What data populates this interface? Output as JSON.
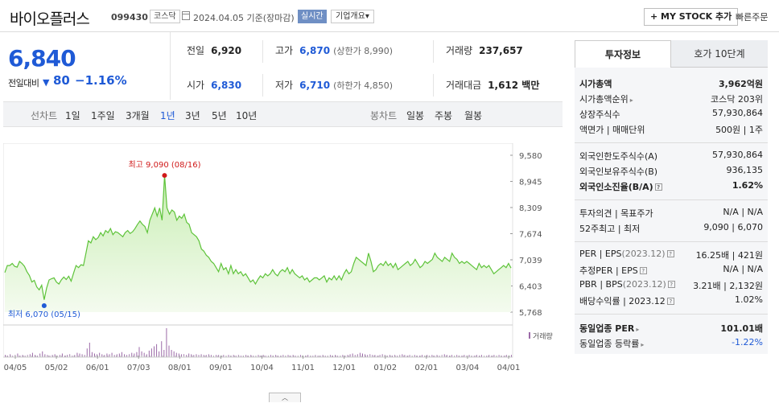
{
  "header": {
    "title": "바이오플러스",
    "code": "099430",
    "market": "코스닥",
    "date": "2024.04.05",
    "status": "기준(장마감)",
    "live": "실시간",
    "company_info": "기업개요",
    "company_info_caret": "▾",
    "mystock": "+ MY STOCK 추가",
    "quick_order": "빠른주문"
  },
  "price": {
    "current": "6,840",
    "change_label": "전일대비",
    "change_symbol": "▼",
    "change": "80",
    "change_pct": "−1.16%"
  },
  "stats": {
    "prev_close": {
      "label": "전일",
      "value": "6,920"
    },
    "high": {
      "label": "고가",
      "value": "6,870",
      "sub": "(상한가 8,990)"
    },
    "volume": {
      "label": "거래량",
      "value": "237,657"
    },
    "open": {
      "label": "시가",
      "value": "6,830"
    },
    "low": {
      "label": "저가",
      "value": "6,710",
      "sub": "(하한가 4,850)"
    },
    "amount": {
      "label": "거래대금",
      "value": "1,612 백만"
    }
  },
  "tabs": {
    "line_label": "선차트",
    "periods": [
      "1일",
      "1주일",
      "3개월",
      "1년",
      "3년",
      "5년",
      "10년"
    ],
    "active": "1년",
    "candle_label": "봉차트",
    "candles": [
      "일봉",
      "주봉",
      "월봉"
    ]
  },
  "chart_data": {
    "type": "area",
    "title": "",
    "xlabel": "",
    "ylabel": "",
    "ylim": [
      5768,
      9580
    ],
    "yticks": [
      "9,580",
      "8,945",
      "8,309",
      "7,674",
      "7,039",
      "6,403",
      "5,768"
    ],
    "x_ticks": [
      "04/05",
      "05/02",
      "06/01",
      "07/03",
      "08/01",
      "09/01",
      "10/04",
      "11/01",
      "12/01",
      "01/02",
      "02/01",
      "03/04",
      "04/01"
    ],
    "series": [
      {
        "values": [
          6730,
          6900,
          6900,
          6950,
          6880,
          6860,
          7000,
          6950,
          6880,
          6750,
          6660,
          6500,
          6540,
          6380,
          6310,
          6420,
          6070,
          6350,
          6550,
          6580,
          6600,
          6500,
          6450,
          6550,
          6620,
          6560,
          6640,
          6520,
          6720,
          6900,
          6850,
          6920,
          6900,
          7200,
          7500,
          7450,
          7600,
          7530,
          7580,
          7700,
          7620,
          7750,
          7700,
          7800,
          7650,
          7720,
          7700,
          7650,
          7600,
          7700,
          7750,
          7680,
          7720,
          7800,
          7900,
          7980,
          7900,
          7850,
          7700,
          8000,
          8150,
          8300,
          8100,
          8300,
          8000,
          9090,
          8300,
          8150,
          8250,
          8200,
          8000,
          8100,
          8050,
          8150,
          7950,
          7900,
          7700,
          7650,
          7600,
          7500,
          7300,
          7250,
          7150,
          7100,
          7000,
          6950,
          6850,
          6750,
          6950,
          6800,
          6850,
          6700,
          6900,
          6700,
          6800,
          6700,
          6750,
          6650,
          6700,
          6600,
          6500,
          6550,
          6450,
          6560,
          6650,
          6600,
          6700,
          6650,
          6700,
          6800,
          6700,
          6650,
          6750,
          6800,
          6750,
          6850,
          6700,
          6800,
          6700,
          6650,
          6600,
          6650,
          6550,
          6600,
          6500,
          6550,
          6600,
          6600,
          6550,
          6600,
          6650,
          6500,
          6600,
          6550,
          6650,
          6550,
          6650,
          6550,
          6700,
          6800,
          6700,
          6750,
          6950,
          7100,
          7050,
          7000,
          6950,
          6900,
          7200,
          7000,
          6750,
          6800,
          6900,
          6950,
          6900,
          7000,
          6900,
          6950,
          6850,
          6950,
          6800,
          6850,
          6900,
          6950,
          7000,
          6900,
          6950,
          7050,
          6950,
          6850,
          6900,
          7000,
          6950,
          7000,
          7050,
          7200,
          7100,
          7050,
          7000,
          7100,
          7050,
          7000,
          7200,
          7100,
          7050,
          6950,
          7000,
          6950,
          7000,
          6950,
          6900,
          6850,
          6800,
          6950,
          6850,
          6900,
          6850,
          6900,
          6800,
          6700,
          6750,
          6800,
          6850,
          6900,
          6850,
          6950,
          6840
        ]
      }
    ],
    "max_label": "최고 9,090 (08/16)",
    "min_label": "최저 6,070 (05/15)",
    "max_index": 65,
    "min_index": 16,
    "volume_label": "거래량",
    "volume": [
      3,
      2,
      4,
      2,
      3,
      5,
      2,
      3,
      2,
      3,
      4,
      6,
      3,
      2,
      5,
      8,
      4,
      3,
      2,
      3,
      4,
      2,
      3,
      5,
      2,
      3,
      4,
      2,
      3,
      6,
      5,
      4,
      3,
      12,
      20,
      7,
      5,
      4,
      6,
      4,
      3,
      5,
      4,
      6,
      3,
      4,
      5,
      7,
      4,
      3,
      4,
      6,
      5,
      7,
      14,
      8,
      6,
      4,
      9,
      12,
      15,
      18,
      8,
      22,
      10,
      40,
      16,
      10,
      8,
      6,
      5,
      4,
      4,
      3,
      5,
      4,
      3,
      4,
      3,
      4,
      3,
      3,
      4,
      3,
      2,
      3,
      3,
      2,
      3,
      2,
      3,
      2,
      3,
      2,
      3,
      2,
      2,
      3,
      2,
      3,
      2,
      2,
      3,
      2,
      3,
      2,
      2,
      3,
      2,
      3,
      2,
      2,
      3,
      2,
      3,
      2,
      3,
      2,
      2,
      3,
      2,
      2,
      3,
      2,
      2,
      3,
      2,
      2,
      3,
      2,
      2,
      3,
      2,
      3,
      2,
      2,
      3,
      2,
      3,
      4,
      5,
      3,
      4,
      6,
      5,
      4,
      3,
      4,
      3,
      3,
      2,
      3,
      4,
      3,
      2,
      3,
      2,
      3,
      2,
      3,
      4,
      3,
      2,
      3,
      2,
      3,
      2,
      2,
      3,
      2,
      3,
      2,
      3,
      2,
      3,
      2,
      3,
      4,
      3,
      2,
      3,
      2,
      3,
      2,
      2,
      3,
      2,
      3,
      2,
      2,
      3,
      2,
      3,
      2,
      2,
      3,
      2,
      3,
      2,
      3,
      2,
      2,
      3,
      2,
      3
    ]
  },
  "side": {
    "tab_invest": "투자정보",
    "tab_orderbook": "호가 10단계",
    "market_cap": {
      "label": "시가총액",
      "value": "3,962억원"
    },
    "cap_rank": {
      "label": "시가총액순위",
      "value": "코스닥 203위"
    },
    "shares": {
      "label": "상장주식수",
      "value": "57,930,864"
    },
    "par": {
      "label": "액면가 | 매매단위",
      "value": "500원 | 1주"
    },
    "foreign_limit": {
      "label": "외국인한도주식수(A)",
      "value": "57,930,864"
    },
    "foreign_hold": {
      "label": "외국인보유주식수(B)",
      "value": "936,135"
    },
    "foreign_ratio": {
      "label": "외국인소진율(B/A)",
      "value": "1.62%"
    },
    "opinion": {
      "label": "투자의견 | 목표주가",
      "value": "N/A | N/A"
    },
    "w52": {
      "label": "52주최고 | 최저",
      "value": "9,090 | 6,070"
    },
    "per": {
      "label": "PER | EPS",
      "label_sub": "(2023.12)",
      "value": "16.25배 | 421원"
    },
    "est_per": {
      "label": "추정PER | EPS",
      "value": "N/A | N/A"
    },
    "pbr": {
      "label": "PBR | BPS",
      "label_sub": "(2023.12)",
      "value": "3.21배 | 2,132원"
    },
    "dividend": {
      "label": "배당수익률",
      "label_sub": "| 2023.12",
      "value": "1.02%"
    },
    "sector_per": {
      "label": "동일업종 PER",
      "value": "101.01배"
    },
    "sector_rate": {
      "label": "동일업종 등락률",
      "value": "-1.22%"
    }
  },
  "colors": {
    "up": "#d01a1a",
    "down": "#1f5ad6",
    "area_line": "#5ec33a",
    "area_fill": "#e8f8df"
  }
}
